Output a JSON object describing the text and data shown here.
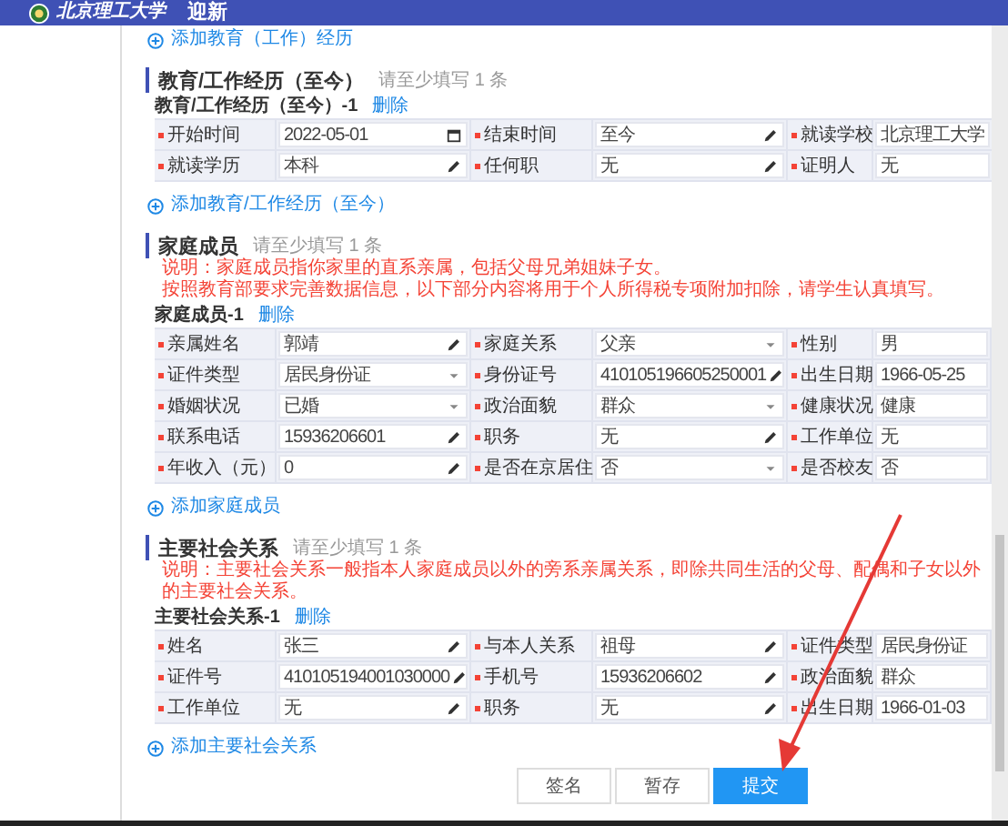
{
  "header": {
    "logo_text": "北京理工大学",
    "title": "迎新"
  },
  "top_link": "添加教育（工作）经历",
  "sections": [
    {
      "title": "教育/工作经历（至今）",
      "hint": "请至少填写 1 条",
      "records": [
        {
          "title": "教育/工作经历（至今）-1",
          "delete": "删除",
          "fields": [
            {
              "label": "开始时间",
              "value": "2022-05-01",
              "kind": "date",
              "required": true
            },
            {
              "label": "结束时间",
              "value": "至今",
              "kind": "text",
              "required": true
            },
            {
              "label": "就读学校",
              "value": "北京理工大学",
              "kind": "plain",
              "required": true
            },
            {
              "label": "就读学历",
              "value": "本科",
              "kind": "text",
              "required": true
            },
            {
              "label": "任何职",
              "value": "无",
              "kind": "text",
              "required": true
            },
            {
              "label": "证明人",
              "value": "无",
              "kind": "plain",
              "required": true
            }
          ]
        }
      ],
      "add_link": "添加教育/工作经历（至今）"
    },
    {
      "title": "家庭成员",
      "hint": "请至少填写 1 条",
      "notes": [
        "说明：家庭成员指你家里的直系亲属，包括父母兄弟姐妹子女。",
        "按照教育部要求完善数据信息，以下部分内容将用于个人所得税专项附加扣除，请学生认真填写。"
      ],
      "records": [
        {
          "title": "家庭成员-1",
          "delete": "删除",
          "fields": [
            {
              "label": "亲属姓名",
              "value": "郭靖",
              "kind": "text",
              "required": true
            },
            {
              "label": "家庭关系",
              "value": "父亲",
              "kind": "select",
              "required": true
            },
            {
              "label": "性别",
              "value": "男",
              "kind": "plain",
              "required": true
            },
            {
              "label": "证件类型",
              "value": "居民身份证",
              "kind": "select",
              "required": true
            },
            {
              "label": "身份证号",
              "value": "410105196605250001",
              "kind": "text",
              "required": true
            },
            {
              "label": "出生日期",
              "value": "1966-05-25",
              "kind": "plain",
              "required": true
            },
            {
              "label": "婚姻状况",
              "value": "已婚",
              "kind": "select",
              "required": true
            },
            {
              "label": "政治面貌",
              "value": "群众",
              "kind": "select",
              "required": true
            },
            {
              "label": "健康状况",
              "value": "健康",
              "kind": "plain",
              "required": true
            },
            {
              "label": "联系电话",
              "value": "15936206601",
              "kind": "text",
              "required": true
            },
            {
              "label": "职务",
              "value": "无",
              "kind": "text",
              "required": true
            },
            {
              "label": "工作单位",
              "value": "无",
              "kind": "plain",
              "required": true
            },
            {
              "label": "年收入（元）",
              "value": "0",
              "kind": "text",
              "required": true
            },
            {
              "label": "是否在京居住",
              "value": "否",
              "kind": "select",
              "required": true
            },
            {
              "label": "是否校友",
              "value": "否",
              "kind": "plain",
              "required": true
            }
          ]
        }
      ],
      "add_link": "添加家庭成员"
    },
    {
      "title": "主要社会关系",
      "hint": "请至少填写 1 条",
      "notes": [
        "说明：主要社会关系一般指本人家庭成员以外的旁系亲属关系，即除共同生活的父母、配偶和子女以外的主要社会关系。"
      ],
      "records": [
        {
          "title": "主要社会关系-1",
          "delete": "删除",
          "fields": [
            {
              "label": "姓名",
              "value": "张三",
              "kind": "text",
              "required": true
            },
            {
              "label": "与本人关系",
              "value": "祖母",
              "kind": "text",
              "required": true
            },
            {
              "label": "证件类型",
              "value": "居民身份证",
              "kind": "plain",
              "required": true
            },
            {
              "label": "证件号",
              "value": "410105194001030000",
              "kind": "text",
              "required": true
            },
            {
              "label": "手机号",
              "value": "15936206602",
              "kind": "text",
              "required": true
            },
            {
              "label": "政治面貌",
              "value": "群众",
              "kind": "plain",
              "required": true
            },
            {
              "label": "工作单位",
              "value": "无",
              "kind": "text",
              "required": true
            },
            {
              "label": "职务",
              "value": "无",
              "kind": "text",
              "required": true
            },
            {
              "label": "出生日期",
              "value": "1966-01-03",
              "kind": "plain",
              "required": true
            }
          ]
        }
      ],
      "add_link": "添加主要社会关系"
    }
  ],
  "buttons": [
    {
      "label": "签名",
      "kind": "default"
    },
    {
      "label": "暂存",
      "kind": "default"
    },
    {
      "label": "提交",
      "kind": "primary"
    }
  ]
}
